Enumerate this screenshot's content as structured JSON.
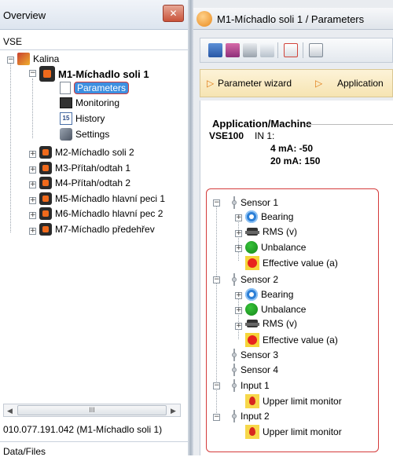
{
  "left_panel": {
    "title": "Overview",
    "close_glyph": "✕",
    "root_label": "VSE",
    "tree": {
      "kalina": "Kalina",
      "m1": "M1-Míchadlo soli 1",
      "m1_children": [
        "Parameters",
        "Monitoring",
        "History",
        "Settings"
      ],
      "machines": [
        "M2-Míchadlo soli 2",
        "M3-Přítah/odtah 1",
        "M4-Přítah/odtah 2",
        "M5-Míchadlo hlavní peci 1",
        "M6-Míchadlo hlavní pec 2",
        "M7-Míchadlo předehřev"
      ]
    },
    "scroll_thumb": "III",
    "status": "010.077.191.042 (M1-Míchadlo soli 1)",
    "bottom_tab": "Data/Files"
  },
  "right_panel": {
    "title": "M1-Míchadlo soli 1 / Parameters",
    "wizard_items": [
      "Parameter wizard",
      "Application"
    ],
    "application": {
      "title": "Application/Machine",
      "model": "VSE100",
      "input": "IN 1:",
      "line_4ma": "4 mA: -50",
      "line_20ma": "20 mA: 150"
    },
    "params": {
      "sensor1": "Sensor 1",
      "sensor1_children": [
        "Bearing",
        "RMS (v)",
        "Unbalance",
        "Effective value (a)"
      ],
      "sensor2": "Sensor 2",
      "sensor2_children": [
        "Bearing",
        "Unbalance",
        "RMS (v)",
        "Effective value (a)"
      ],
      "sensor3": "Sensor 3",
      "sensor4": "Sensor 4",
      "input1": "Input 1",
      "input1_child": "Upper limit monitor",
      "input2": "Input 2",
      "input2_child": "Upper limit monitor"
    }
  }
}
